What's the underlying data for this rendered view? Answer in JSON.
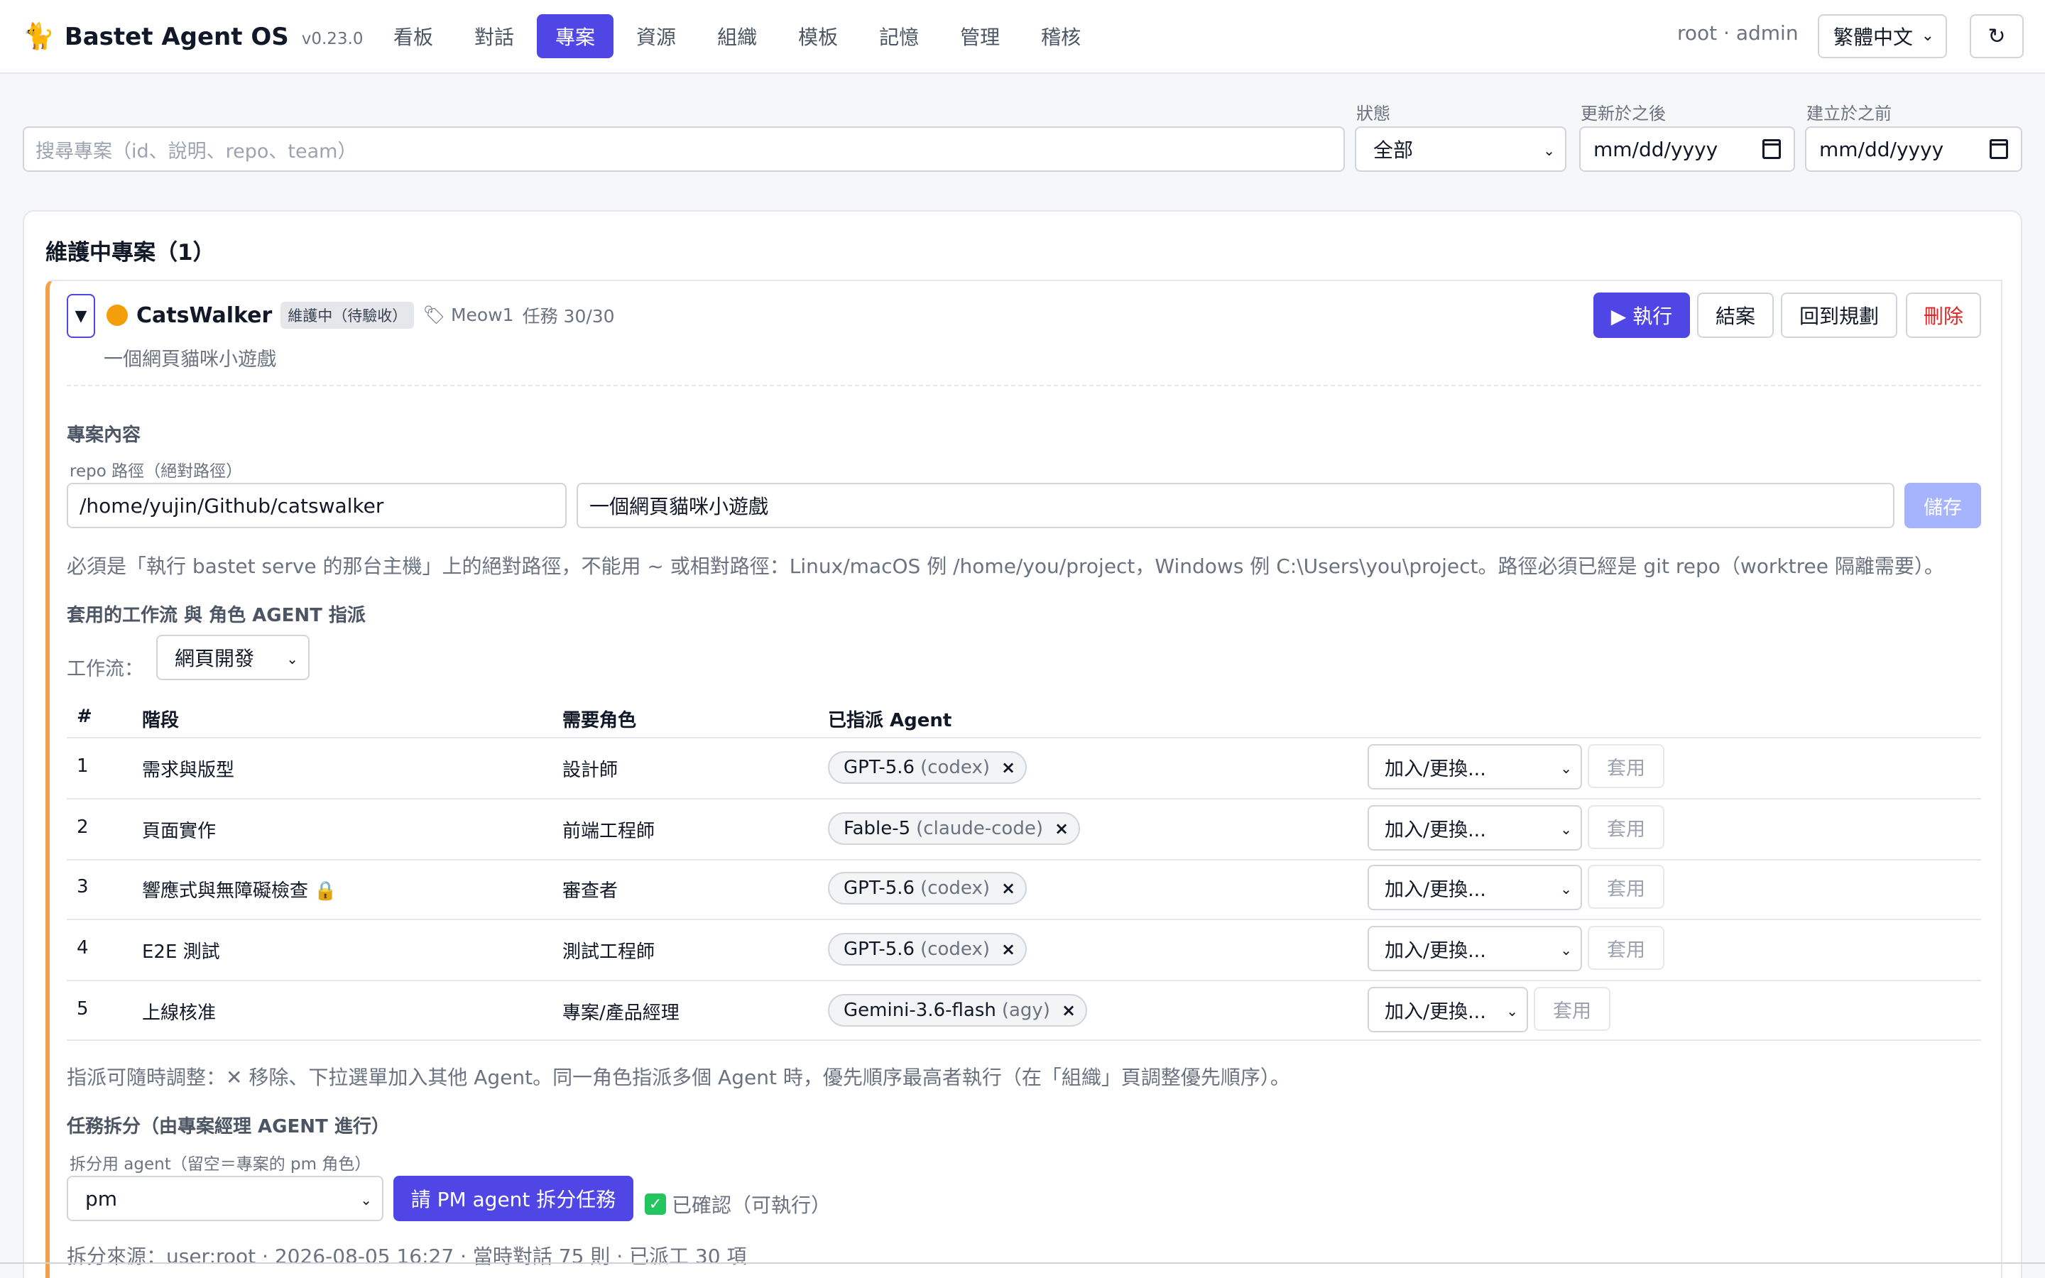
{
  "app": {
    "icon": "cat-icon",
    "name": "Bastet Agent OS",
    "version": "v0.23.0"
  },
  "nav": {
    "tabs": [
      "看板",
      "對話",
      "專案",
      "資源",
      "組織",
      "模板",
      "記憶",
      "管理",
      "稽核"
    ],
    "active": "專案",
    "accent_color": "#4f46e5"
  },
  "user": {
    "info": "root · admin",
    "language": "繁體中文",
    "refresh_icon": "↻"
  },
  "filters": {
    "search_placeholder": "搜尋專案（id、說明、repo、team）",
    "status_label": "狀態",
    "status_value": "全部",
    "updated_after_label": "更新於之後",
    "updated_after_value": "mm/dd/yyyy",
    "created_before_label": "建立於之前",
    "created_before_value": "mm/dd/yyyy"
  },
  "section": {
    "title": "維護中專案（1）"
  },
  "project": {
    "toggle": "▼",
    "status_dot_color": "#f59e0b",
    "name": "CatsWalker",
    "status": "維護中（待驗收）",
    "tag": "🏷 Meow1",
    "tasks": "任務 30/30",
    "description": "一個網頁貓咪小遊戲",
    "actions": {
      "run": "▶ 執行",
      "close": "結案",
      "back_to_plan": "回到規劃",
      "delete": "刪除"
    },
    "content": {
      "title": "專案內容",
      "repo_label": "repo 路徑（絕對路徑）",
      "repo_value": "/home/yujin/Github/catswalker",
      "desc_value": "一個網頁貓咪小遊戲",
      "save": "儲存",
      "repo_hint": "必須是「執行 bastet serve 的那台主機」上的絕對路徑，不能用 ~ 或相對路徑：Linux/macOS 例 /home/you/project，Windows 例 C:\\Users\\you\\project。路徑必須已經是 git repo（worktree 隔離需要）。"
    },
    "workflow": {
      "title": "套用的工作流 與 角色 AGENT 指派",
      "label": "工作流：",
      "value": "網頁開發",
      "columns": [
        "#",
        "階段",
        "需要角色",
        "已指派 Agent"
      ],
      "rows": [
        {
          "num": "1",
          "stage": "需求與版型",
          "role": "設計師",
          "agent": "GPT-5.6",
          "runtime": "(codex)",
          "select": "加入/更換...",
          "apply": "套用"
        },
        {
          "num": "2",
          "stage": "頁面實作",
          "role": "前端工程師",
          "agent": "Fable-5",
          "runtime": "(claude-code)",
          "select": "加入/更換...",
          "apply": "套用"
        },
        {
          "num": "3",
          "stage": "響應式與無障礙檢查 🔒",
          "role": "審查者",
          "agent": "GPT-5.6",
          "runtime": "(codex)",
          "select": "加入/更換...",
          "apply": "套用"
        },
        {
          "num": "4",
          "stage": "E2E 測試",
          "role": "測試工程師",
          "agent": "GPT-5.6",
          "runtime": "(codex)",
          "select": "加入/更換...",
          "apply": "套用"
        },
        {
          "num": "5",
          "stage": "上線核准",
          "role": "專案/產品經理",
          "agent": "Gemini-3.6-flash",
          "runtime": "(agy)",
          "select": "加入/更換...",
          "apply": "套用"
        }
      ],
      "remove_symbol": "×",
      "hint": "指派可隨時調整：✕ 移除、下拉選單加入其他 Agent。同一角色指派多個 Agent 時，優先順序最高者執行（在「組織」頁調整優先順序）。"
    },
    "split": {
      "title": "任務拆分（由專案經理 AGENT 進行）",
      "agent_label": "拆分用 agent（留空＝專案的 pm 角色）",
      "agent_value": "pm",
      "button": "請 PM agent 拆分任務",
      "confirmed_icon": "✓",
      "confirmed": "已確認（可執行）",
      "source": "拆分來源：user:root · 2026-08-05 16:27 · 當時對話 75 則 · 已派工 30 項"
    }
  }
}
